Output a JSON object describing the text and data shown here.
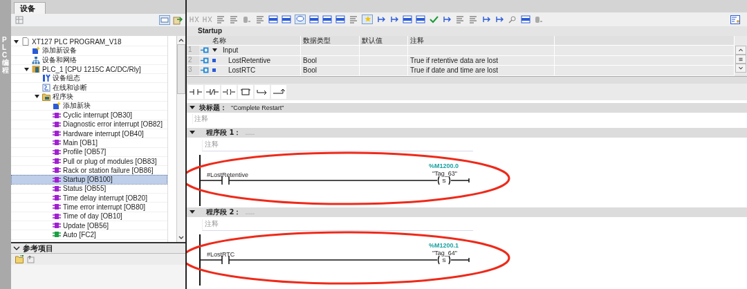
{
  "side_strip": {
    "label": "PLC 编程"
  },
  "devices_panel": {
    "tab": "设备",
    "tree": [
      {
        "label": "XT127 PLC PROGRAM_V18",
        "kind": "project",
        "expanded": true,
        "selected": false,
        "children": [
          {
            "label": "添加新设备",
            "kind": "add-device",
            "selected": false
          },
          {
            "label": "设备和网络",
            "kind": "network",
            "selected": false
          },
          {
            "label": "PLC_1 [CPU 1215C AC/DC/Rly]",
            "kind": "plc",
            "expanded": true,
            "selected": false,
            "children": [
              {
                "label": "设备组态",
                "kind": "config",
                "selected": false
              },
              {
                "label": "在线和诊断",
                "kind": "diagnostics",
                "selected": false
              },
              {
                "label": "程序块",
                "kind": "folder",
                "expanded": true,
                "selected": false,
                "children": [
                  {
                    "label": "添加新块",
                    "kind": "add-block",
                    "selected": false
                  },
                  {
                    "label": "Cyclic interrupt [OB30]",
                    "kind": "ob",
                    "selected": false
                  },
                  {
                    "label": "Diagnostic error interrupt [OB82]",
                    "kind": "ob",
                    "selected": false
                  },
                  {
                    "label": "Hardware interrupt [OB40]",
                    "kind": "ob",
                    "selected": false
                  },
                  {
                    "label": "Main [OB1]",
                    "kind": "ob",
                    "selected": false
                  },
                  {
                    "label": "Profile [OB57]",
                    "kind": "ob",
                    "selected": false
                  },
                  {
                    "label": "Pull or plug of modules [OB83]",
                    "kind": "ob",
                    "selected": false
                  },
                  {
                    "label": "Rack or station failure [OB86]",
                    "kind": "ob",
                    "selected": false
                  },
                  {
                    "label": "Startup [OB100]",
                    "kind": "ob",
                    "selected": true
                  },
                  {
                    "label": "Status [OB55]",
                    "kind": "ob",
                    "selected": false
                  },
                  {
                    "label": "Time delay interrupt [OB20]",
                    "kind": "ob",
                    "selected": false
                  },
                  {
                    "label": "Time error interrupt [OB80]",
                    "kind": "ob",
                    "selected": false
                  },
                  {
                    "label": "Time of day [OB10]",
                    "kind": "ob",
                    "selected": false
                  },
                  {
                    "label": "Update [OB56]",
                    "kind": "ob",
                    "selected": false
                  },
                  {
                    "label": "Auto [FC2]",
                    "kind": "fc",
                    "selected": false
                  }
                ]
              }
            ]
          }
        ]
      }
    ]
  },
  "reference_panel": {
    "title": "参考项目",
    "expanded": true
  },
  "editor": {
    "block_name": "Startup",
    "interface": {
      "columns": [
        "名称",
        "数据类型",
        "默认值",
        "注释"
      ],
      "rows": [
        {
          "number": "1",
          "kind": "section",
          "name": "Input",
          "expanded": true
        },
        {
          "number": "2",
          "kind": "variable",
          "name": "LostRetentive",
          "data_type": "Bool",
          "comment": "True if retentive data are lost"
        },
        {
          "number": "3",
          "kind": "variable",
          "name": "LostRTC",
          "data_type": "Bool",
          "comment": "True if date and time are lost"
        }
      ]
    },
    "block_title": {
      "label": "块标题：",
      "value": "\"Complete Restart\"",
      "comment": "注释"
    },
    "networks": [
      {
        "label": "程序段 1：",
        "title": ".....",
        "comment": "注释",
        "contact": "#LostRetentive",
        "address": "%M1200.0",
        "tag": "\"Tag_63\"",
        "coil": "S",
        "highlighted": true
      },
      {
        "label": "程序段 2：",
        "title": ".....",
        "comment": "注释",
        "contact": "#LostRTC",
        "address": "%M1200.1",
        "tag": "\"Tag_64\"",
        "coil": "S",
        "highlighted": true
      }
    ]
  }
}
